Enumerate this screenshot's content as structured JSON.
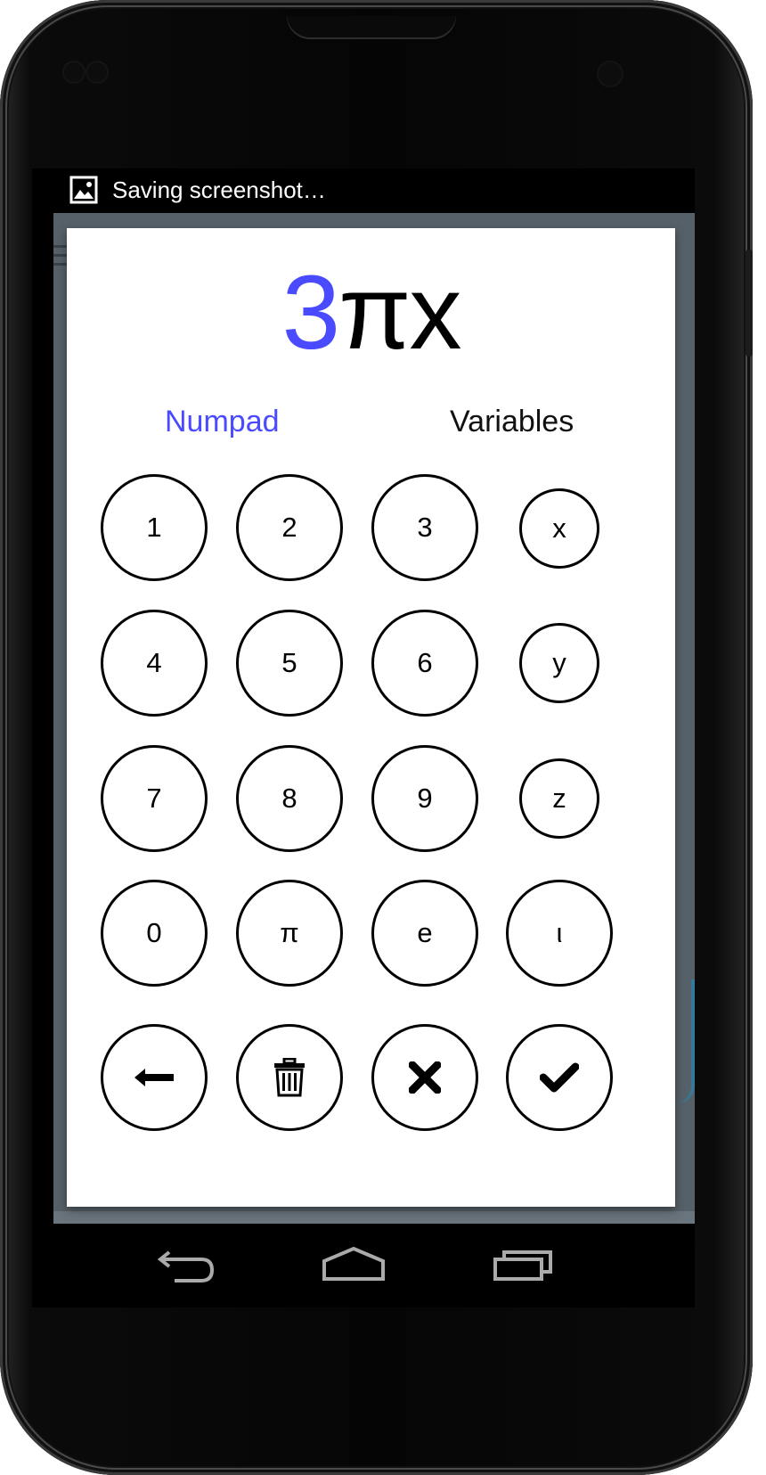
{
  "status_bar": {
    "notification_icon": "image-icon",
    "notification_text": "Saving screenshot…"
  },
  "dialog": {
    "expression": {
      "highlighted": "3",
      "rest": "πx"
    },
    "tabs": {
      "numpad": "Numpad",
      "variables": "Variables",
      "active": "numpad",
      "active_color": "#4a4aff"
    },
    "keys": {
      "k1": "1",
      "k2": "2",
      "k3": "3",
      "kx": "x",
      "k4": "4",
      "k5": "5",
      "k6": "6",
      "ky": "y",
      "k7": "7",
      "k8": "8",
      "k9": "9",
      "kz": "z",
      "k0": "0",
      "kpi": "π",
      "ke": "e",
      "ki": "ι"
    },
    "action_keys": [
      "backspace-icon",
      "trash-icon",
      "close-icon",
      "check-icon"
    ]
  },
  "navbar": {
    "buttons": [
      "back-icon",
      "home-icon",
      "recent-apps-icon"
    ]
  }
}
